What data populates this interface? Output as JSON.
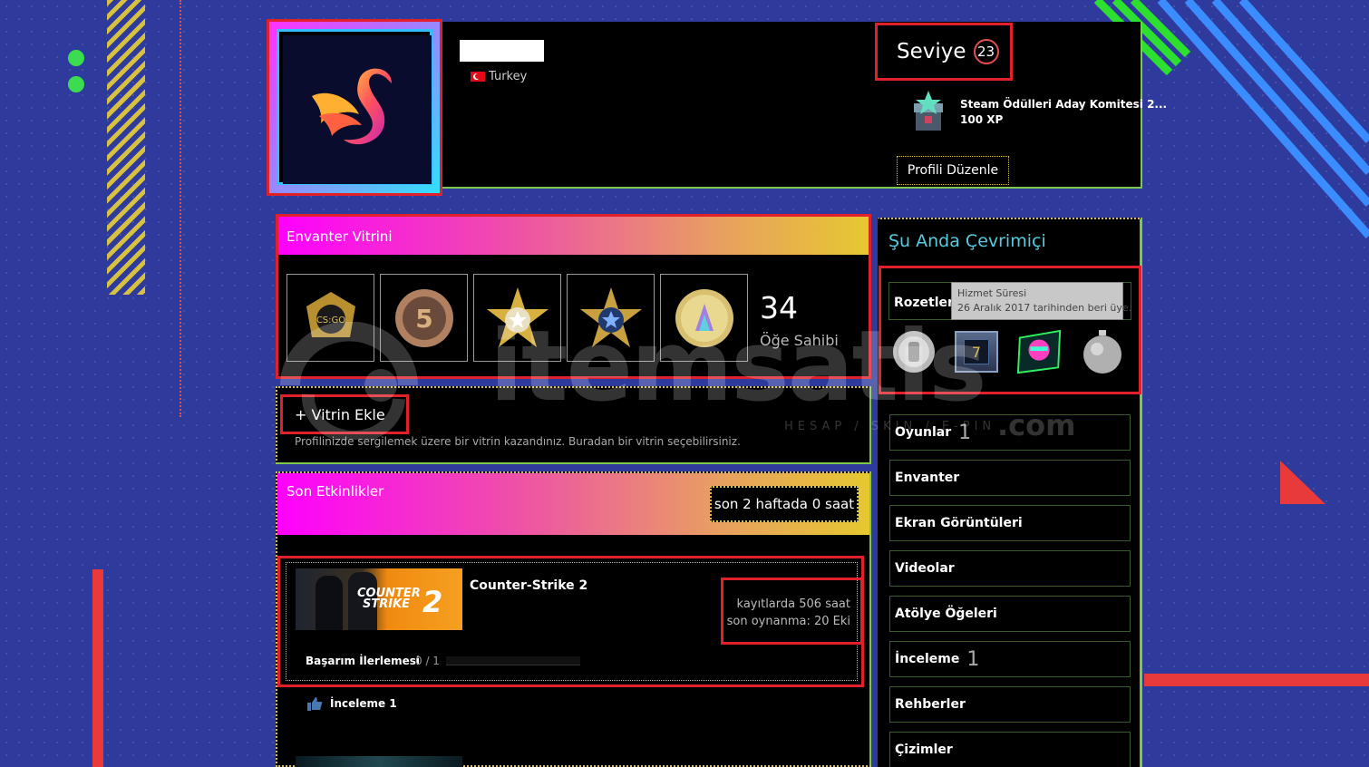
{
  "header": {
    "country": "Turkey",
    "level_label": "Seviye",
    "level_value": "23",
    "award_title": "Steam Ödülleri Aday Komitesi 2...",
    "award_xp": "100 XP",
    "edit_profile": "Profili Düzenle"
  },
  "showcase": {
    "title": "Envanter Vitrini",
    "count": "34",
    "count_label": "Öğe Sahibi"
  },
  "add_showcase": {
    "label": "+ Vitrin Ekle",
    "description": "Profilinizde sergilemek üzere bir vitrin kazandınız. Buradan bir vitrin seçebilirsiniz."
  },
  "activity": {
    "title": "Son Etkinlikler",
    "hours_badge": "son 2 haftada 0 saat",
    "game_name": "Counter-Strike 2",
    "logo_line1": "COUNTER",
    "logo_line2": "STRIKE",
    "logo_num": "2",
    "hours_on_record": "kayıtlarda 506 saat",
    "last_played": "son oynanma: 20 Eki",
    "achievement_label": "Başarım İlerlemesi",
    "achievement_value": "0 / 1",
    "review_label": "İnceleme 1"
  },
  "sidebar": {
    "online_title": "Şu Anda Çevrimiçi",
    "badges_label": "Rozetler",
    "tooltip_title": "Hizmet Süresi",
    "tooltip_text": "26 Aralık 2017 tarihinden beri üye.",
    "badge_num": "7",
    "items": [
      {
        "label": "Oyunlar",
        "count": "1"
      },
      {
        "label": "Envanter",
        "count": ""
      },
      {
        "label": "Ekran Görüntüleri",
        "count": ""
      },
      {
        "label": "Videolar",
        "count": ""
      },
      {
        "label": "Atölye Öğeleri",
        "count": ""
      },
      {
        "label": "İnceleme",
        "count": "1"
      },
      {
        "label": "Rehberler",
        "count": ""
      },
      {
        "label": "Çizimler",
        "count": ""
      }
    ]
  },
  "watermark": {
    "brand": "itemsatis",
    "suffix": ".com",
    "tagline": "HESAP / SKIN / E-PIN"
  },
  "colors": {
    "background": "#2e3a9c",
    "highlight_red": "#e0202a",
    "border_green": "#7ec850",
    "online_blue": "#57cbde"
  }
}
